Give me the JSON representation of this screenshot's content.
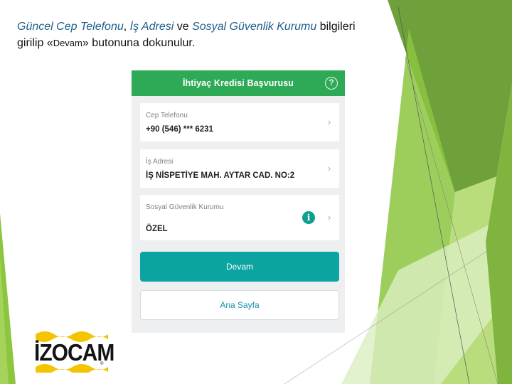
{
  "instruction": {
    "part1": "Güncel Cep Telefonu",
    "sep1": ", ",
    "part2": "İş Adresi",
    "sep2": " ve ",
    "part3": "Sosyal Güvenlik Kurumu",
    "part4": " bilgileri",
    "line2_start": "girilip «",
    "line2_devam": "Devam",
    "line2_end": "» butonuna dokunulur."
  },
  "app": {
    "title": "İhtiyaç Kredisi Başvurusu",
    "help_icon": "question-circle-icon",
    "fields": [
      {
        "label": "Cep Telefonu",
        "value": "+90 (546) *** 6231"
      },
      {
        "label": "İş Adresi",
        "value": "İŞ NİSPETİYE MAH. AYTAR CAD. NO:2"
      },
      {
        "label": "Sosyal Güvenlik Kurumu",
        "value": "ÖZEL",
        "info_icon": "info-icon"
      }
    ],
    "primary_button": "Devam",
    "secondary_button": "Ana Sayfa"
  },
  "logo": {
    "text": "İZOCAM",
    "registered": "®"
  },
  "colors": {
    "header_green": "#2eaa57",
    "primary_teal": "#0ca4a1",
    "secondary_text": "#1c8fa8",
    "instruction_highlight": "#1f5f8a",
    "logo_yellow": "#f5c400",
    "deco_green": "#8cc63f"
  }
}
